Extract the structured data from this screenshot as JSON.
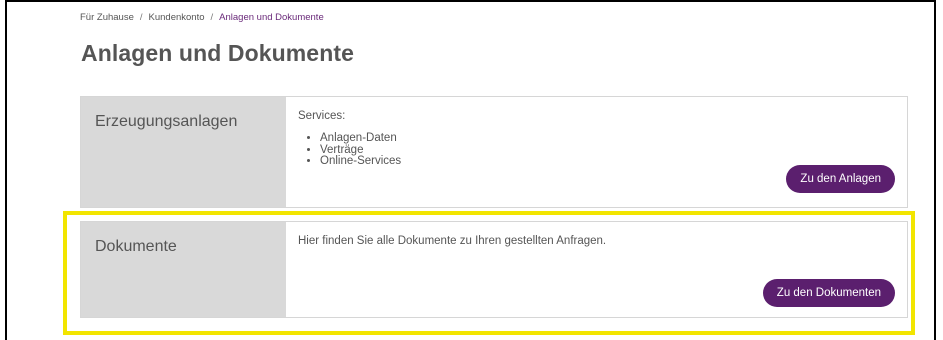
{
  "breadcrumb": {
    "items": [
      "Für Zuhause",
      "Kundenkonto",
      "Anlagen und Dokumente"
    ],
    "separator": "/"
  },
  "page_title": "Anlagen und Dokumente",
  "cards": [
    {
      "title": "Erzeugungsanlagen",
      "services_label": "Services:",
      "services": [
        "Anlagen-Daten",
        "Verträge",
        "Online-Services"
      ],
      "button_label": "Zu den Anlagen"
    },
    {
      "title": "Dokumente",
      "description": "Hier finden Sie alle Dokumente zu Ihren gestellten Anfragen.",
      "button_label": "Zu den Dokumenten"
    }
  ],
  "colors": {
    "accent": "#5b1f6e",
    "highlight": "#f2e500",
    "sidebar_bg": "#d9d9d9"
  }
}
